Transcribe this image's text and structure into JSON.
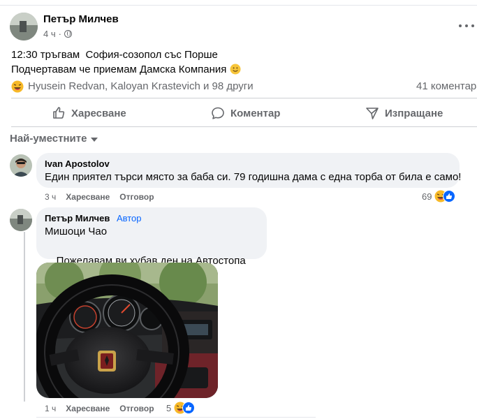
{
  "post": {
    "author": "Петър Милчев",
    "time": "4 ч",
    "lines": [
      "12:30 тръгвам  София-созопол със Порше",
      "Подчертавам че приемам Дамска Компания"
    ],
    "reactions_text": "Hyusein Redvan, Kaloyan Krastevich и 98 други",
    "comments_count": "41 коментара"
  },
  "actions": {
    "like": "Харесване",
    "comment": "Коментар",
    "share": "Изпращане"
  },
  "sort": {
    "label": "Най-уместните"
  },
  "comments": [
    {
      "author": "Ivan Apostolov",
      "text": "Един приятел търси място за баба си. 79 годишна дама с една торба от била е само!",
      "time": "3 ч",
      "like": "Харесване",
      "reply": "Отговор",
      "reactions": "69"
    },
    {
      "author": "Петър Милчев",
      "badge": "Автор",
      "lines": [
        "Мишоци Чао",
        "Пожелавам ви хубав ден на Автостопа"
      ],
      "time": "1 ч",
      "like": "Харесване",
      "reply": "Отговор",
      "reactions": "5"
    }
  ],
  "icons": [
    "globe-icon",
    "more-icon",
    "like-icon",
    "comment-icon",
    "share-icon",
    "haha-emoji-icon",
    "smile-emoji-icon",
    "sunglasses-emoji-icon",
    "thumbs-up-reaction-icon"
  ],
  "colors": {
    "accent": "#0866ff",
    "muted": "#65676b",
    "bubble": "#f0f2f5",
    "text": "#050505"
  }
}
